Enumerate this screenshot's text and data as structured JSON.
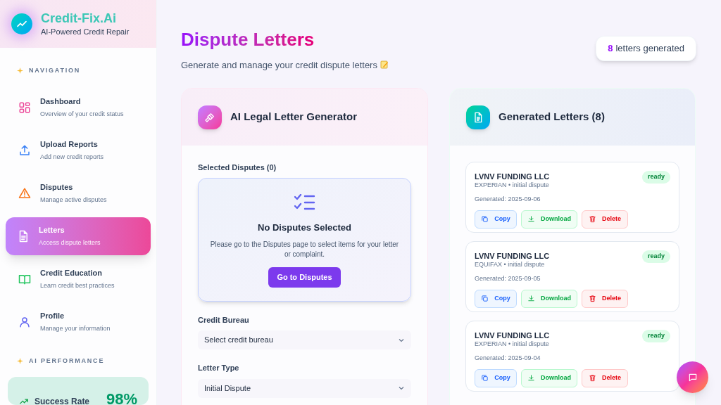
{
  "brand": {
    "name": "Credit-Fix.Ai",
    "tagline": "AI-Powered Credit Repair"
  },
  "navigation": {
    "heading": "NAVIGATION",
    "items": [
      {
        "kind": "dashboard",
        "title": "Dashboard",
        "subtitle": "Overview of your credit status",
        "selected": false
      },
      {
        "kind": "upload",
        "title": "Upload Reports",
        "subtitle": "Add new credit reports",
        "selected": false
      },
      {
        "kind": "disputes",
        "title": "Disputes",
        "subtitle": "Manage active disputes",
        "selected": false
      },
      {
        "kind": "letters",
        "title": "Letters",
        "subtitle": "Access dispute letters",
        "selected": true
      },
      {
        "kind": "education",
        "title": "Credit Education",
        "subtitle": "Learn credit best practices",
        "selected": false
      },
      {
        "kind": "profile",
        "title": "Profile",
        "subtitle": "Manage your information",
        "selected": false
      }
    ]
  },
  "ai_performance": {
    "heading": "AI PERFORMANCE",
    "label": "Success Rate",
    "value": "98%"
  },
  "page": {
    "title": "Dispute Letters",
    "subtitle": "Generate and manage your credit dispute letters",
    "count": "8",
    "count_label": "letters generated"
  },
  "generator": {
    "title": "AI Legal Letter Generator",
    "selected_label": "Selected Disputes (0)",
    "empty": {
      "title": "No Disputes Selected",
      "text": "Please go to the Disputes page to select items for your letter or complaint.",
      "button": "Go to Disputes"
    },
    "fields": [
      {
        "label": "Credit Bureau",
        "value": "Select credit bureau"
      },
      {
        "label": "Letter Type",
        "value": "Initial Dispute"
      }
    ]
  },
  "letters": {
    "title": "Generated Letters (8)",
    "items": [
      {
        "creditor": "LVNV FUNDING LLC",
        "details": "EXPERIAN • initial dispute",
        "generated": "Generated: 2025-09-06",
        "status": "ready",
        "actions": [
          "Copy",
          "Download",
          "Delete"
        ]
      },
      {
        "creditor": "LVNV FUNDING LLC",
        "details": "EQUIFAX • initial dispute",
        "generated": "Generated: 2025-09-05",
        "status": "ready",
        "actions": [
          "Copy",
          "Download",
          "Delete"
        ]
      },
      {
        "creditor": "LVNV FUNDING LLC",
        "details": "EXPERIAN • initial dispute",
        "generated": "Generated: 2025-09-04",
        "status": "ready",
        "actions": [
          "Copy",
          "Download",
          "Delete"
        ]
      }
    ]
  }
}
